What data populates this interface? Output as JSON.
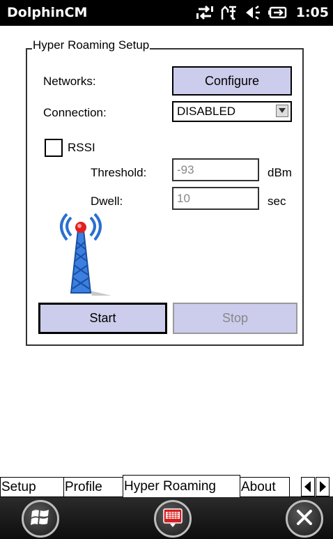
{
  "status_bar": {
    "app_title": "DolphinCM",
    "time": "1:05",
    "icons": [
      "connectivity-icon",
      "signal-icon",
      "speaker-icon",
      "battery-icon"
    ]
  },
  "group": {
    "title": "Hyper Roaming Setup"
  },
  "form": {
    "networks_label": "Networks:",
    "configure_button": "Configure",
    "connection_label": "Connection:",
    "connection_value": "DISABLED",
    "rssi_label": "RSSI",
    "rssi_checked": false,
    "threshold_label": "Threshold:",
    "threshold_value": "-93",
    "threshold_unit": "dBm",
    "dwell_label": "Dwell:",
    "dwell_value": "10",
    "dwell_unit": "sec",
    "start_button": "Start",
    "stop_button": "Stop"
  },
  "tabs": [
    {
      "label": "Setup",
      "active": false
    },
    {
      "label": "Profile",
      "active": false
    },
    {
      "label": "Hyper Roaming",
      "active": true
    },
    {
      "label": "About",
      "active": false
    }
  ],
  "bottom_bar": {
    "icons": [
      "windows-start-icon",
      "keyboard-icon",
      "close-icon"
    ]
  },
  "colors": {
    "button_fill": "#ccccec",
    "status_bar": "#000000",
    "tower_blue": "#2a6fd1",
    "tower_red": "#e02020"
  }
}
